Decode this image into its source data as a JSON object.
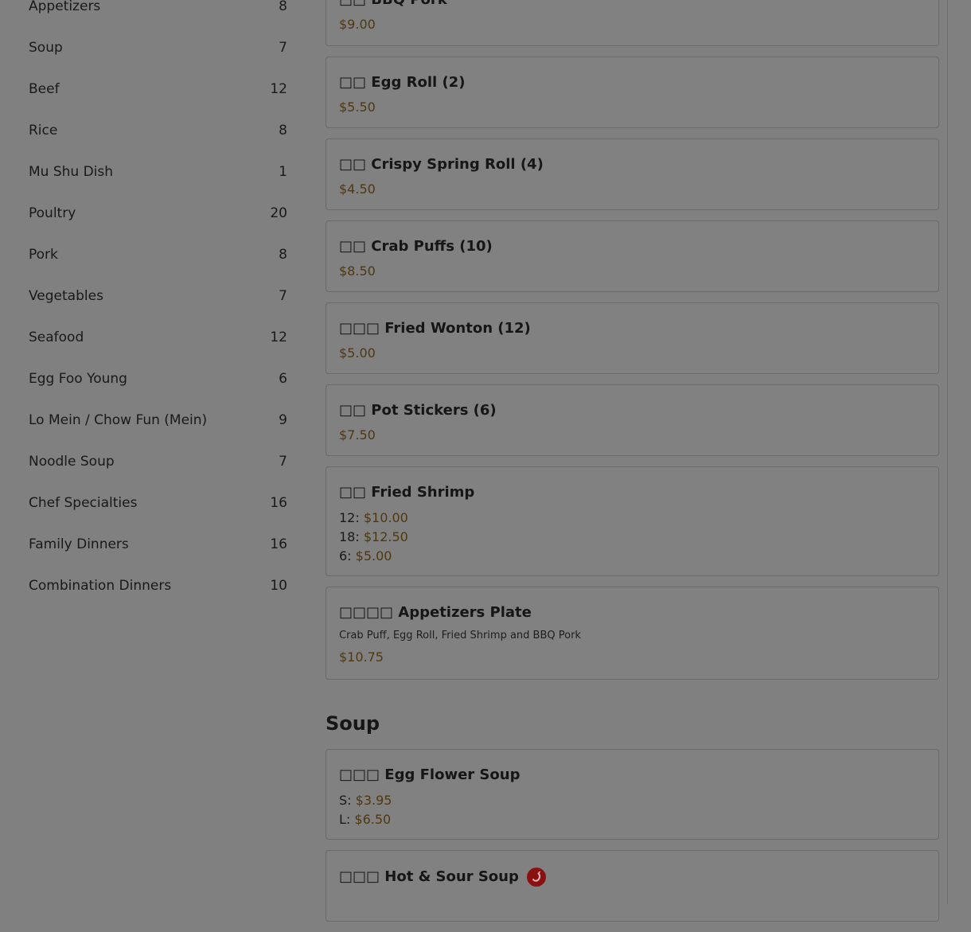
{
  "categories": [
    {
      "name": "Appetizers",
      "count": "8"
    },
    {
      "name": "Soup",
      "count": "7"
    },
    {
      "name": "Beef",
      "count": "12"
    },
    {
      "name": "Rice",
      "count": "8"
    },
    {
      "name": "Mu Shu Dish",
      "count": "1"
    },
    {
      "name": "Poultry",
      "count": "20"
    },
    {
      "name": "Pork",
      "count": "8"
    },
    {
      "name": "Vegetables",
      "count": "7"
    },
    {
      "name": "Seafood",
      "count": "12"
    },
    {
      "name": "Egg Foo Young",
      "count": "6"
    },
    {
      "name": "Lo Mein / Chow Fun (Mein)",
      "count": "9"
    },
    {
      "name": "Noodle Soup",
      "count": "7"
    },
    {
      "name": "Chef Specialties",
      "count": "16"
    },
    {
      "name": "Family Dinners",
      "count": "16"
    },
    {
      "name": "Combination Dinners",
      "count": "10"
    }
  ],
  "appetizers": [
    {
      "title": "□□ BBQ Pork",
      "price": "$9.00"
    },
    {
      "title": "□□ Egg Roll (2)",
      "price": "$5.50"
    },
    {
      "title": "□□ Crispy Spring Roll (4)",
      "price": "$4.50"
    },
    {
      "title": "□□ Crab Puffs (10)",
      "price": "$8.50"
    },
    {
      "title": "□□□ Fried Wonton (12)",
      "price": "$5.00"
    },
    {
      "title": "□□ Pot Stickers (6)",
      "price": "$7.50"
    },
    {
      "title": "□□ Fried Shrimp",
      "prices": [
        {
          "label": "12:",
          "value": "$10.00"
        },
        {
          "label": "18:",
          "value": "$12.50"
        },
        {
          "label": "6:",
          "value": "$5.00"
        }
      ]
    },
    {
      "title": "□□□□ Appetizers Plate",
      "desc": "Crab Puff, Egg Roll, Fried Shrimp and BBQ Pork",
      "price": "$10.75"
    }
  ],
  "soup_section": {
    "heading": "Soup",
    "items": [
      {
        "title": "□□□ Egg Flower Soup",
        "prices": [
          {
            "label": "S:",
            "value": "$3.95"
          },
          {
            "label": "L:",
            "value": "$6.50"
          }
        ]
      },
      {
        "title": "□□□ Hot & Sour Soup",
        "icon": "spicy-icon"
      }
    ]
  },
  "colors": {
    "overlay": "#808080",
    "price": "#4f3810",
    "spicy": "#8b1111"
  }
}
